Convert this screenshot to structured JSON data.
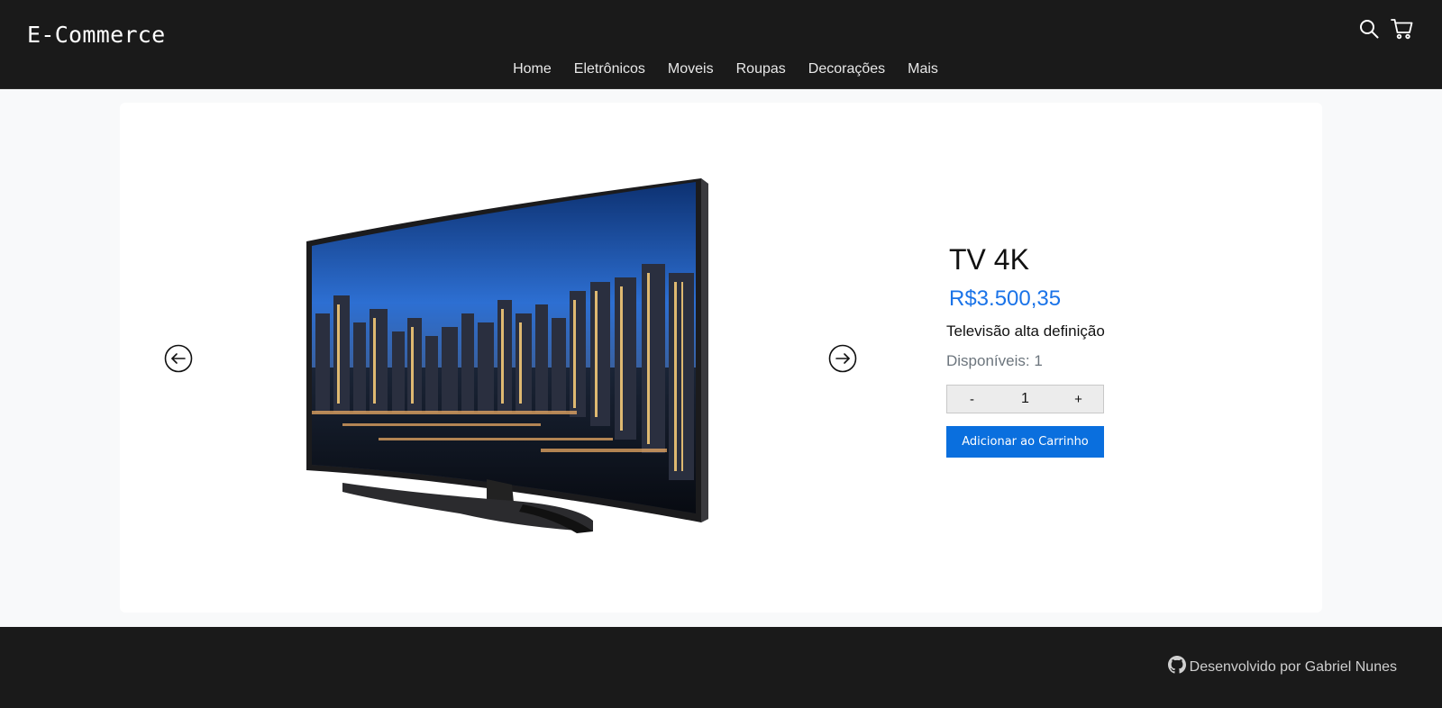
{
  "header": {
    "brand": "E-Commerce",
    "nav": [
      "Home",
      "Eletrônicos",
      "Moveis",
      "Roupas",
      "Decorações",
      "Mais"
    ],
    "icons": {
      "search": "search-icon",
      "cart": "cart-icon"
    }
  },
  "product": {
    "name": "TV 4K",
    "price": "R$3.500,35",
    "description": "Televisão alta definição",
    "available": "Disponíveis: 1",
    "quantity": "1",
    "minus_label": "-",
    "plus_label": "+",
    "add_to_cart_label": "Adicionar ao Carrinho",
    "accent_color": "#0a6fde"
  },
  "carousel": {
    "prev_icon": "arrow-left-circle-icon",
    "next_icon": "arrow-right-circle-icon"
  },
  "footer": {
    "credit": "Desenvolvido por Gabriel Nunes",
    "icon": "github-icon"
  }
}
